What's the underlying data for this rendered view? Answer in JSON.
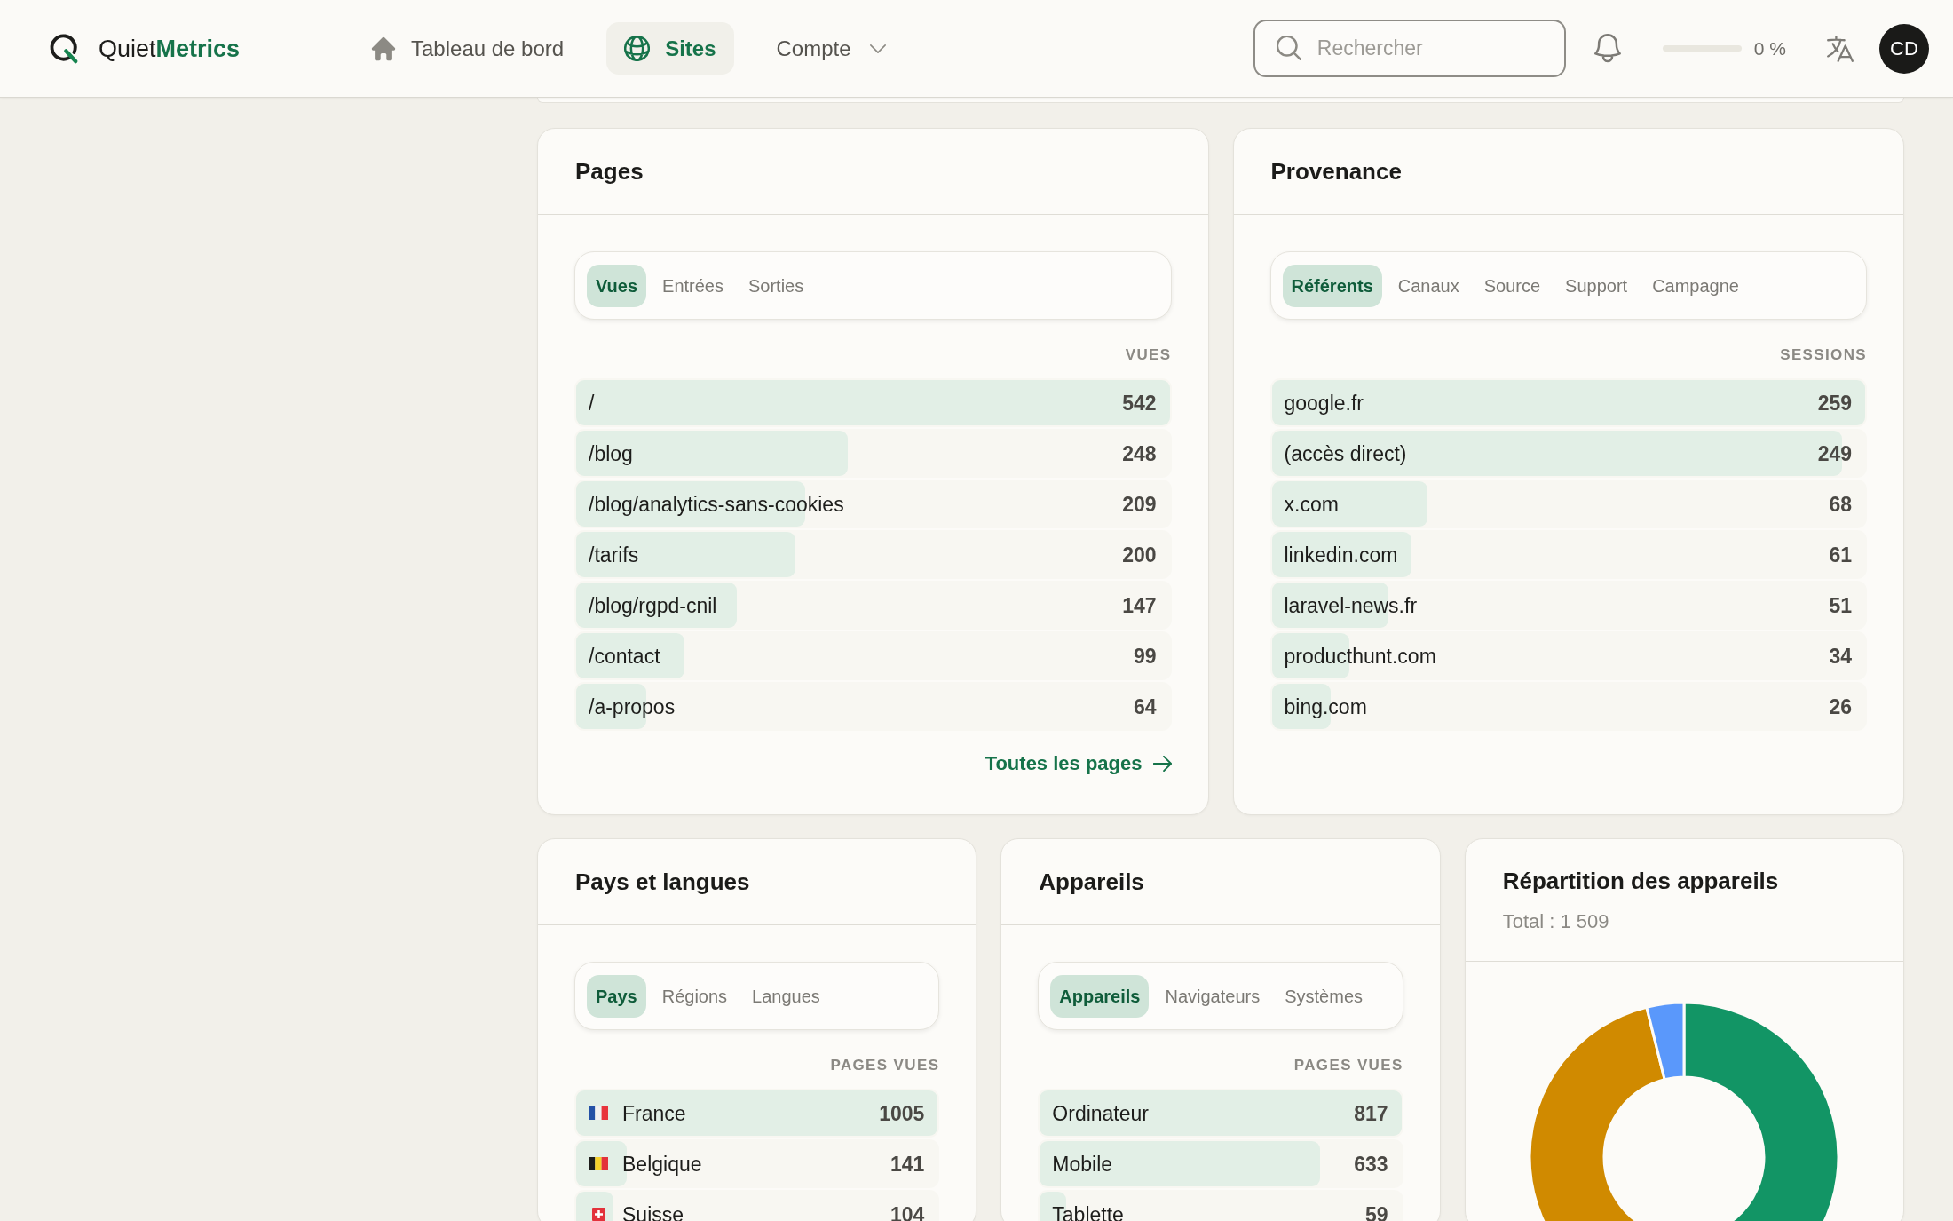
{
  "header": {
    "brand": "Quiet**Metrics**",
    "nav": [
      {
        "kind": "link",
        "label": "Tableau de bord",
        "selected": false
      },
      {
        "kind": "link",
        "label": "Sites",
        "selected": true
      },
      {
        "kind": "dropdown",
        "label": "Compte",
        "selected": false
      }
    ],
    "search": {
      "placeholder": "Rechercher"
    },
    "progress": {
      "level": 0,
      "reading": "0 %"
    },
    "avatar": {
      "initials": "CD"
    }
  },
  "pages": {
    "title": "Pages",
    "tabs": [
      {
        "label": "Vues",
        "selected": true
      },
      {
        "label": "Entrées",
        "selected": false
      },
      {
        "label": "Sorties",
        "selected": false
      }
    ],
    "column": "VUES",
    "rows": [
      {
        "label": "/",
        "value": "542",
        "level": 1
      },
      {
        "label": "/blog",
        "value": "248",
        "level": 0.458
      },
      {
        "label": "/blog/analytics-sans-cookies",
        "value": "209",
        "level": 0.386
      },
      {
        "label": "/tarifs",
        "value": "200",
        "level": 0.369
      },
      {
        "label": "/blog/rgpd-cnil",
        "value": "147",
        "level": 0.271
      },
      {
        "label": "/contact",
        "value": "99",
        "level": 0.183
      },
      {
        "label": "/a-propos",
        "value": "64",
        "level": 0.118
      }
    ],
    "link": "Toutes les pages"
  },
  "sources": {
    "title": "Provenance",
    "tabs": [
      {
        "label": "Référents",
        "selected": true
      },
      {
        "label": "Canaux",
        "selected": false
      },
      {
        "label": "Source",
        "selected": false
      },
      {
        "label": "Support",
        "selected": false
      },
      {
        "label": "Campagne",
        "selected": false
      }
    ],
    "column": "SESSIONS",
    "rows": [
      {
        "label": "google.fr",
        "value": "259",
        "level": 1
      },
      {
        "label": "(accès direct)",
        "value": "249",
        "level": 0.961
      },
      {
        "label": "x.com",
        "value": "68",
        "level": 0.263
      },
      {
        "label": "linkedin.com",
        "value": "61",
        "level": 0.236
      },
      {
        "label": "laravel-news.fr",
        "value": "51",
        "level": 0.197
      },
      {
        "label": "producthunt.com",
        "value": "34",
        "level": 0.131
      },
      {
        "label": "bing.com",
        "value": "26",
        "level": 0.1
      }
    ]
  },
  "countries": {
    "title": "Pays et langues",
    "tabs": [
      {
        "label": "Pays",
        "selected": true
      },
      {
        "label": "Régions",
        "selected": false
      },
      {
        "label": "Langues",
        "selected": false
      }
    ],
    "column": "PAGES VUES",
    "rows": [
      {
        "label": "France",
        "value": "1005",
        "level": 1
      },
      {
        "label": "Belgique",
        "value": "141",
        "level": 0.14
      },
      {
        "label": "Suisse",
        "value": "104",
        "level": 0.103
      }
    ]
  },
  "devices": {
    "title": "Appareils",
    "tabs": [
      {
        "label": "Appareils",
        "selected": true
      },
      {
        "label": "Navigateurs",
        "selected": false
      },
      {
        "label": "Systèmes",
        "selected": false
      }
    ],
    "column": "PAGES VUES",
    "rows": [
      {
        "label": "Ordinateur",
        "value": "817",
        "level": 1
      },
      {
        "label": "Mobile",
        "value": "633",
        "level": 0.775
      },
      {
        "label": "Tablette",
        "value": "59",
        "level": 0.072
      }
    ]
  },
  "device_split": {
    "title": "Répartition des appareils",
    "total": "Total : 1 509"
  }
}
